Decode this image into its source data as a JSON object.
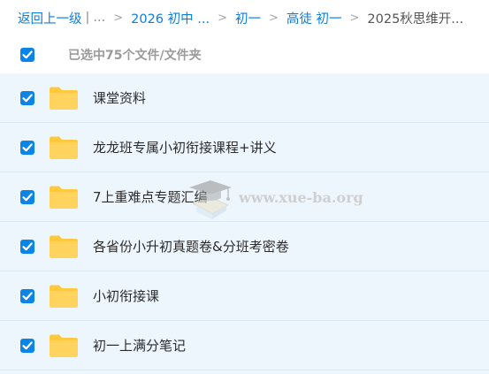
{
  "breadcrumb": {
    "back_label": "返回上一级",
    "pipe": "|",
    "ellipsis": "...",
    "items": [
      {
        "label": "2026 初中 ..."
      },
      {
        "label": "初一"
      },
      {
        "label": "高徒 初一"
      },
      {
        "label": "2025秋思维开..."
      }
    ],
    "separator": ">"
  },
  "selection": {
    "label": "已选中75个文件/文件夹",
    "checked": true
  },
  "files": [
    {
      "name": "课堂资料",
      "type": "folder",
      "checked": true
    },
    {
      "name": "龙龙班专属小初衔接课程+讲义",
      "type": "folder",
      "checked": true
    },
    {
      "name": "7上重难点专题汇编",
      "type": "folder",
      "checked": true
    },
    {
      "name": "各省份小升初真题卷&分班考密卷",
      "type": "folder",
      "checked": true
    },
    {
      "name": "小初衔接课",
      "type": "folder",
      "checked": true
    },
    {
      "name": "初一上满分笔记",
      "type": "folder",
      "checked": true
    }
  ],
  "watermark": {
    "text": "www.xue-ba.org",
    "icon": "graduation-cap-icon"
  },
  "colors": {
    "accent": "#0b84e8",
    "link": "#0b7fe0",
    "folder": "#ffc83d",
    "row_bg": "#eef6fd"
  }
}
